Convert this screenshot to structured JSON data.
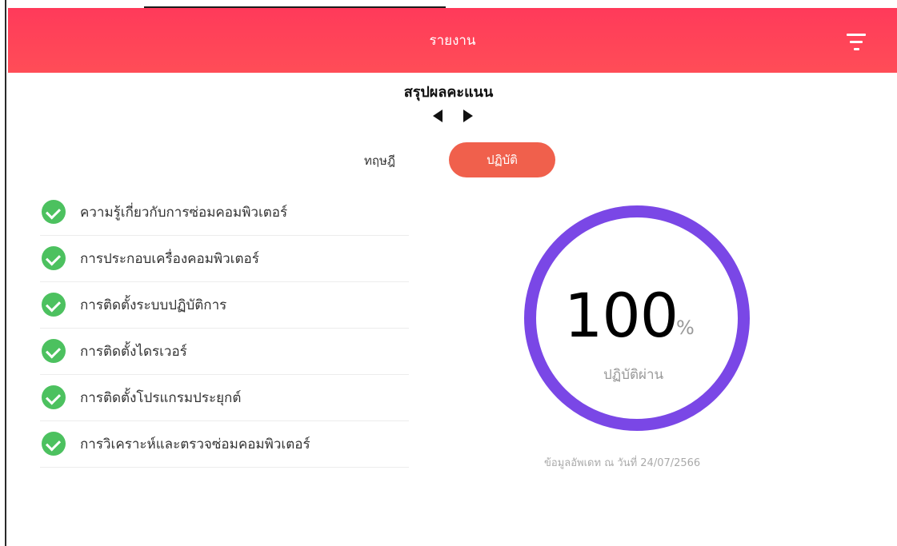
{
  "header": {
    "title": "รายงาน",
    "menu_icon": "filter-menu-icon"
  },
  "summary": {
    "title": "สรุปผลคะแนน",
    "prev_icon": "triangle-left-icon",
    "next_icon": "triangle-right-icon"
  },
  "tabs": [
    {
      "label": "ทฤษฎี",
      "active": false
    },
    {
      "label": "ปฏิบัติ",
      "active": true
    }
  ],
  "topics": [
    {
      "label": "ความรู้เกี่ยวกับการซ่อมคอมพิวเตอร์",
      "passed": true
    },
    {
      "label": "การประกอบเครื่องคอมพิวเตอร์",
      "passed": true
    },
    {
      "label": "การติดตั้งระบบปฏิบัติการ",
      "passed": true
    },
    {
      "label": "การติดตั้งไดรเวอร์",
      "passed": true
    },
    {
      "label": "การติดตั้งโปรแกรมประยุกต์",
      "passed": true
    },
    {
      "label": "การวิเคราะห์และตรวจซ่อมคอมพิวเตอร์",
      "passed": true
    }
  ],
  "score": {
    "value": "100",
    "unit": "%",
    "label": "ปฏิบัติผ่าน",
    "ring_fraction": 1.0
  },
  "updated_text": "ข้อมูลอัพเดท ณ วันที่ 24/07/2566",
  "colors": {
    "header": "#ff4557",
    "tab_active": "#f0604c",
    "ring": "#7a47e6",
    "check": "#4cc15f"
  }
}
